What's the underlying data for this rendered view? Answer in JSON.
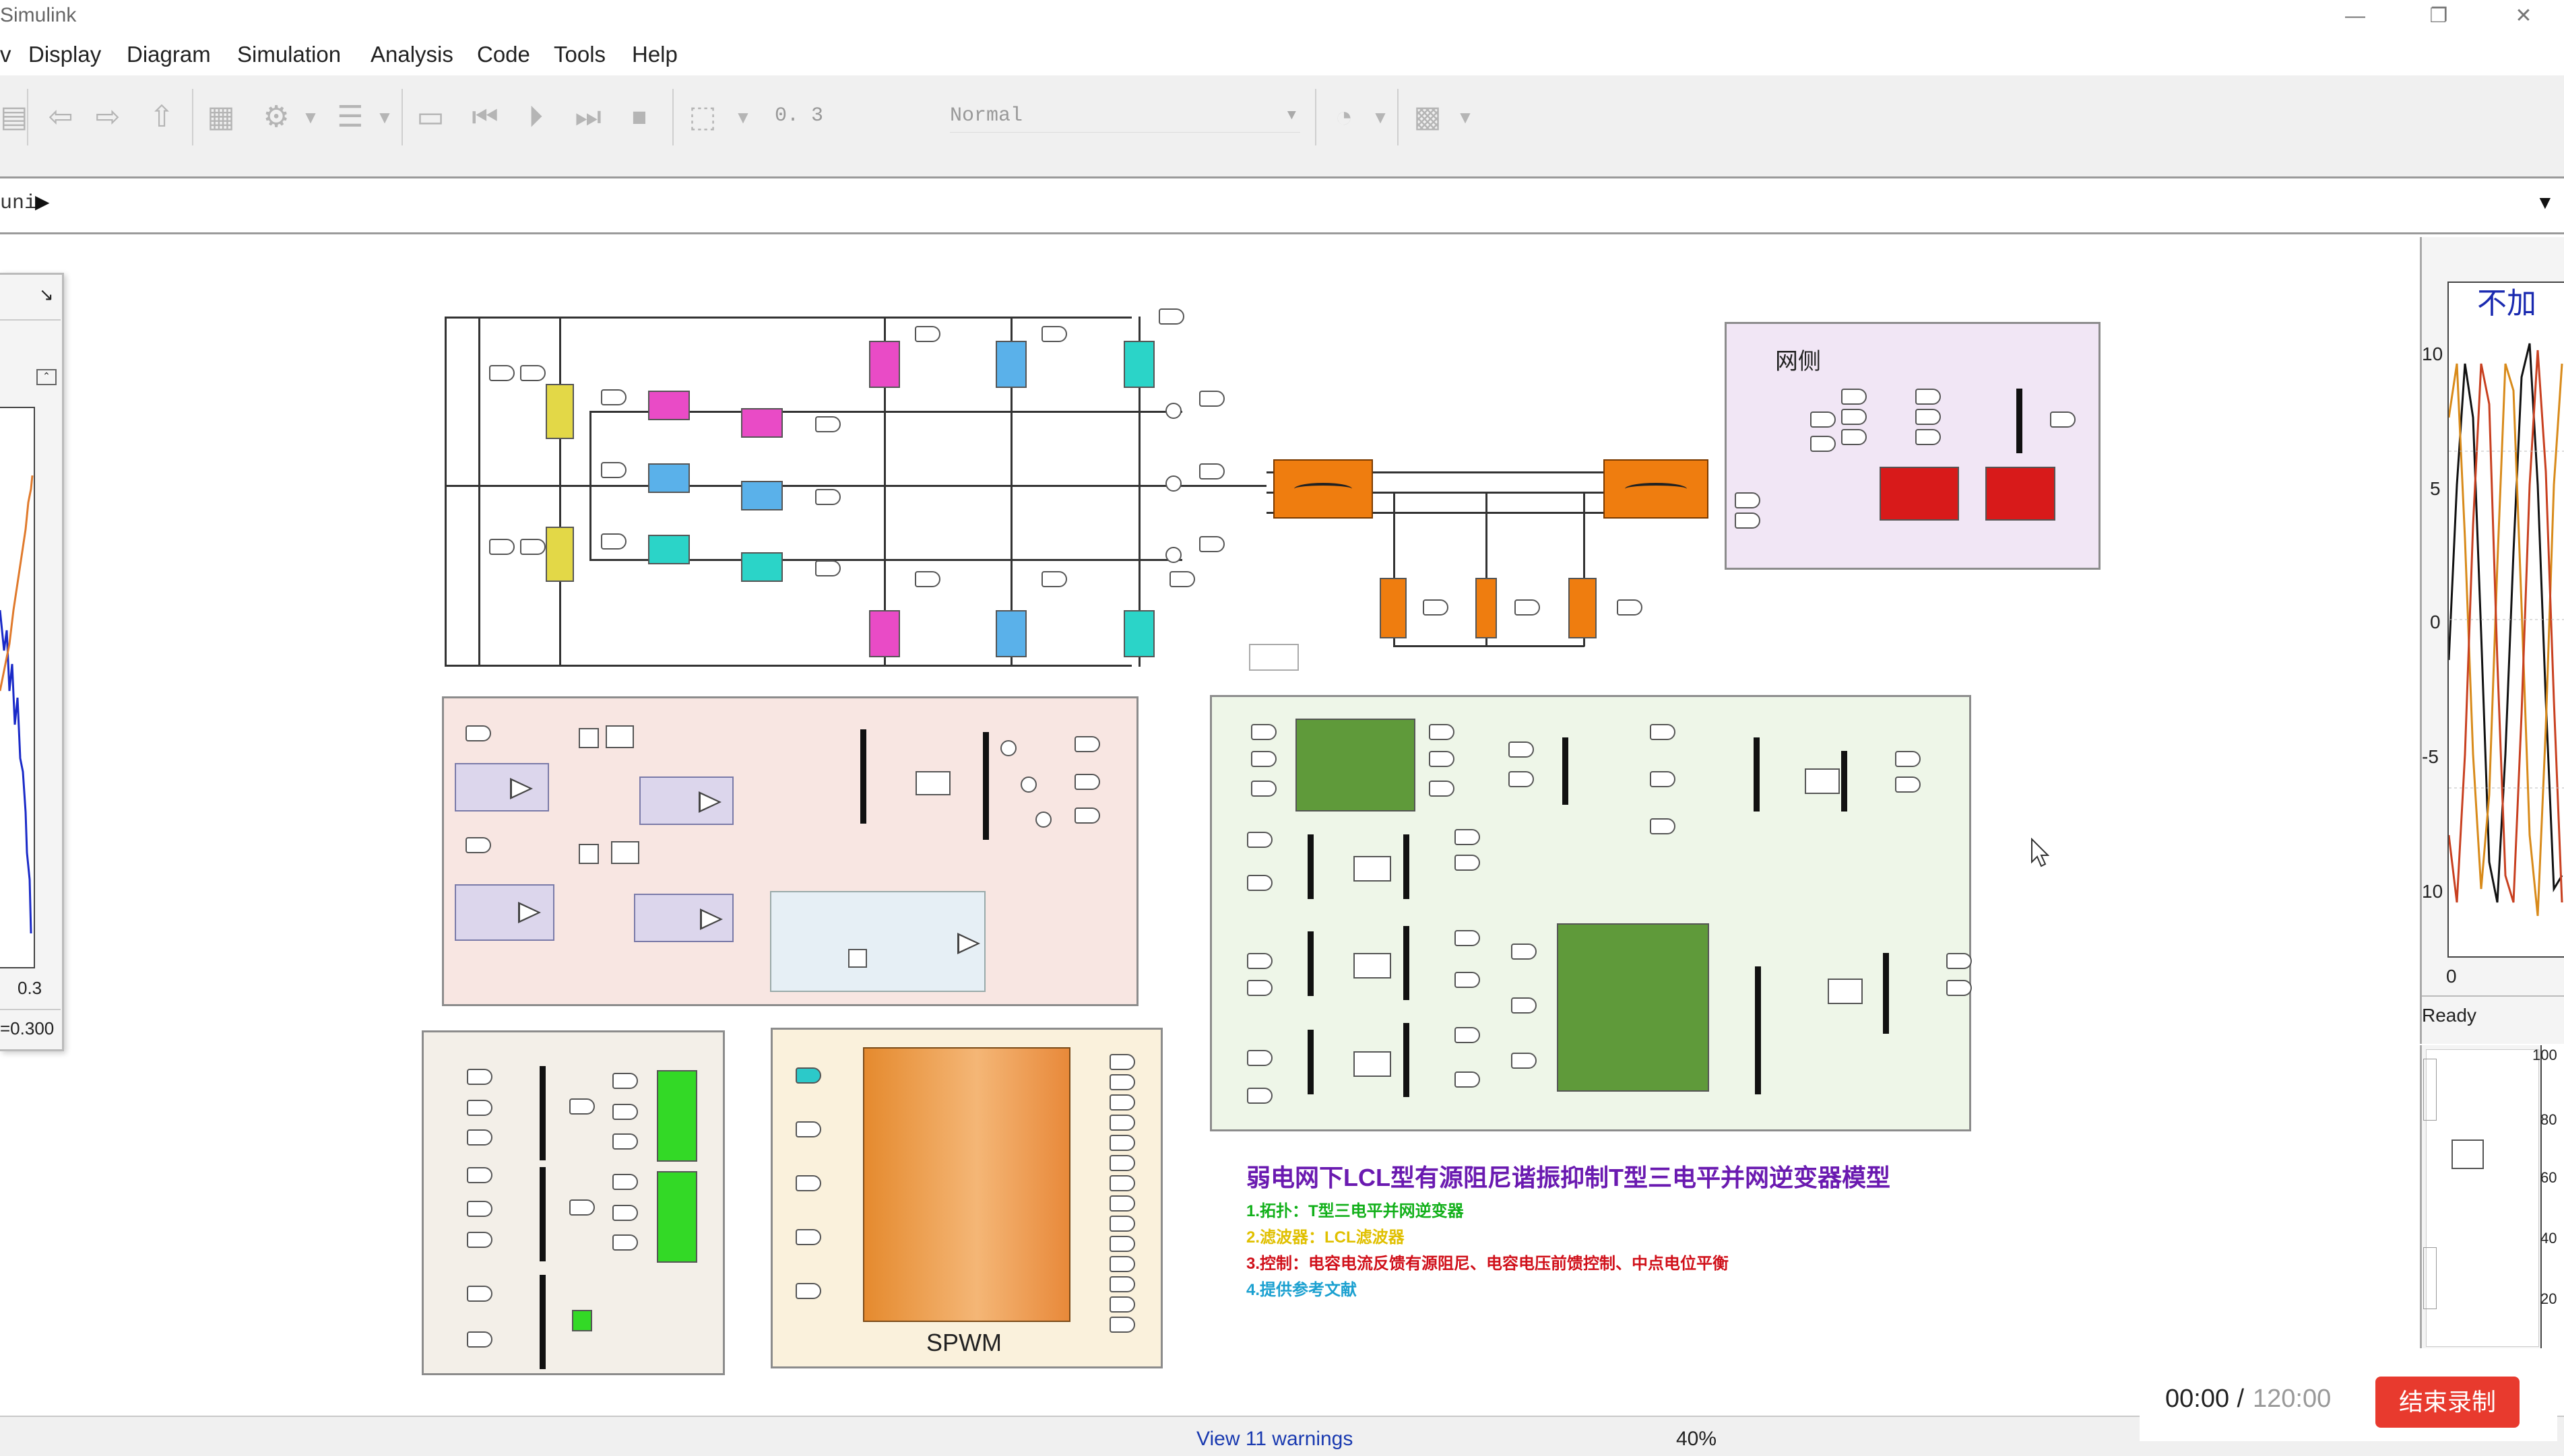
{
  "window": {
    "title": "Simulink",
    "minimize_glyph": "—",
    "restore_glyph": "❐",
    "close_glyph": "✕"
  },
  "menu": [
    "Display",
    "Diagram",
    "Simulation",
    "Analysis",
    "Code",
    "Tools",
    "Help"
  ],
  "menu_edge": "v",
  "toolbar": {
    "stop_time": "0. 3",
    "sim_mode": "Normal"
  },
  "address": {
    "path": "uni",
    "arrow": "▶",
    "dropdown": "▼"
  },
  "left_scope": {
    "axis_max": "0.3",
    "readout": "=0.300",
    "close_glyph": "↘"
  },
  "right_scope": {
    "title": "不加",
    "y_ticks": [
      "10",
      "5",
      "0",
      "-5",
      "10"
    ],
    "x_tick": "0",
    "status": "Ready",
    "small_ticks": [
      "100",
      "80",
      "60",
      "40",
      "20"
    ]
  },
  "blocks": {
    "grid_side_label": "网侧",
    "spwm_label": "SPWM"
  },
  "annotation": {
    "title": "弱电网下LCL型有源阻尼谐振抑制T型三电平并网逆变器模型",
    "lines": [
      "1.拓扑：T型三电平并网逆变器",
      "2.滤波器：LCL滤波器",
      "3.控制：电容电流反馈有源阻尼、电容电压前馈控制、中点电位平衡",
      "4.提供参考文献"
    ],
    "colors": [
      "#6a1ab0",
      "#12b01a",
      "#e0c000",
      "#d0101a",
      "#1aa0d0"
    ]
  },
  "recording": {
    "elapsed": "00:00",
    "separator": " / ",
    "total": "120:00",
    "stop_label": "结束录制"
  },
  "status": {
    "warnings": "View 11 warnings",
    "zoom": "40%"
  }
}
